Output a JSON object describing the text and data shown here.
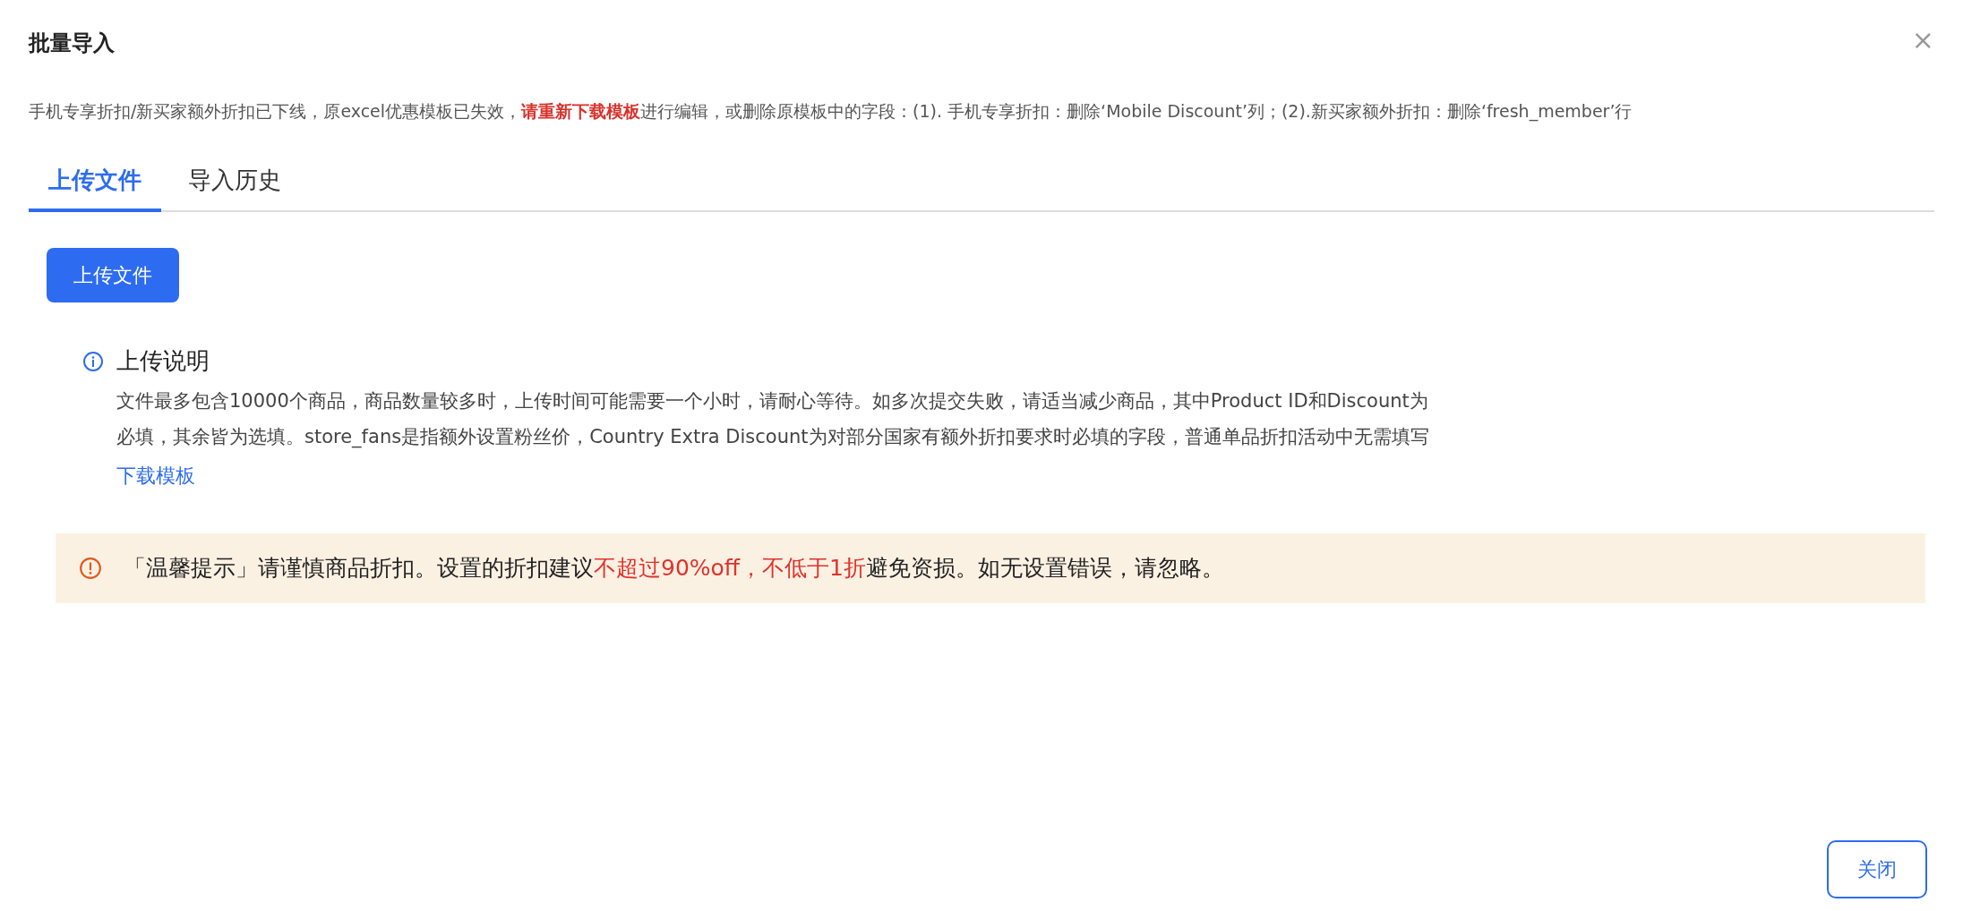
{
  "dialog": {
    "title": "批量导入",
    "close_icon": "×"
  },
  "notice": [
    {
      "kind": "text",
      "text": "手机专享折扣/新买家额外折扣已下线，原excel优惠模板已失效，"
    },
    {
      "kind": "link",
      "text": "请重新下载模板"
    },
    {
      "kind": "text",
      "text": "进行编辑，或删除原模板中的字段：(1). 手机专享折扣：删除‘Mobile Discount’列；(2).新买家额外折扣：删除‘fresh_member’行"
    }
  ],
  "tabs": [
    {
      "label": "上传文件",
      "selected": true
    },
    {
      "label": "导入历史",
      "selected": false
    }
  ],
  "upload_button": "上传文件",
  "instructions": {
    "title": "上传说明",
    "lines": [
      "文件最多包含10000个商品，商品数量较多时，上传时间可能需要一个小时，请耐心等待。如多次提交失败，请适当减少商品，其中Product ID和Discount为",
      "必填，其余皆为选填。store_fans是指额外设置粉丝价，Country Extra Discount为对部分国家有额外折扣要求时必填的字段，普通单品折扣活动中无需填写"
    ],
    "link": "下载模板"
  },
  "warning": [
    {
      "kind": "text",
      "text": "「温馨提示」请谨慎商品折扣。设置的折扣建议"
    },
    {
      "kind": "highlight",
      "text": "不超过90%off，不低于1折"
    },
    {
      "kind": "text",
      "text": "避免资损。如无设置错误，请忽略。"
    }
  ],
  "footer": {
    "close_button": "关闭"
  }
}
